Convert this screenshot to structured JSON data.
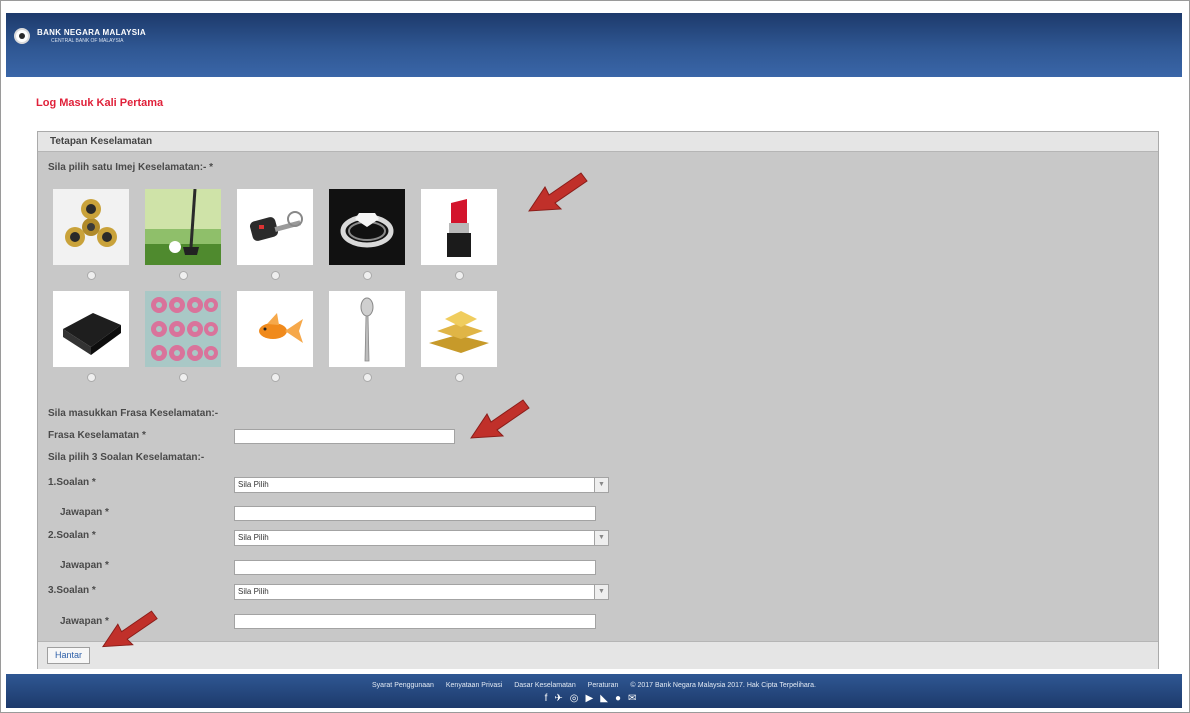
{
  "header": {
    "bank_name": "BANK NEGARA MALAYSIA",
    "bank_sub": "CENTRAL BANK OF MALAYSIA"
  },
  "page": {
    "title": "Log Masuk Kali Pertama"
  },
  "panel": {
    "heading": "Tetapan Keselamatan"
  },
  "security_image": {
    "label": "Sila pilih satu Imej Keselamatan:- *",
    "images": [
      "fidget-spinner",
      "golf-club-and-ball",
      "car-key",
      "diamond-ring",
      "lipstick",
      "black-box",
      "donuts",
      "goldfish",
      "spoon",
      "gold-bars"
    ]
  },
  "phrase": {
    "section_label": "Sila masukkan Frasa Keselamatan:-",
    "field_label": "Frasa Keselamatan *",
    "value": ""
  },
  "questions": {
    "section_label": "Sila pilih 3 Soalan Keselamatan:-",
    "q1": {
      "label": "1.Soalan *",
      "selected": "Sila Pilih",
      "answer_label": "Jawapan *"
    },
    "q2": {
      "label": "2.Soalan *",
      "selected": "Sila Pilih",
      "answer_label": "Jawapan *"
    },
    "q3": {
      "label": "3.Soalan *",
      "selected": "Sila Pilih",
      "answer_label": "Jawapan *"
    }
  },
  "submit_label": "Hantar",
  "footer": {
    "links": [
      "Syarat Penggunaan",
      "Kenyataan Privasi",
      "Dasar Keselamatan",
      "Peraturan",
      "© 2017 Bank Negara Malaysia 2017. Hak Cipta Terpelihara."
    ],
    "social_icons": [
      "facebook-icon",
      "twitter-icon",
      "instagram-icon",
      "youtube-icon",
      "rss-icon",
      "pinterest-icon",
      "email-icon"
    ]
  },
  "colors": {
    "header": "#2f5793",
    "title_red": "#e0213a",
    "panel_gray": "#c8c8c8",
    "arrow_red": "#c0302a"
  }
}
